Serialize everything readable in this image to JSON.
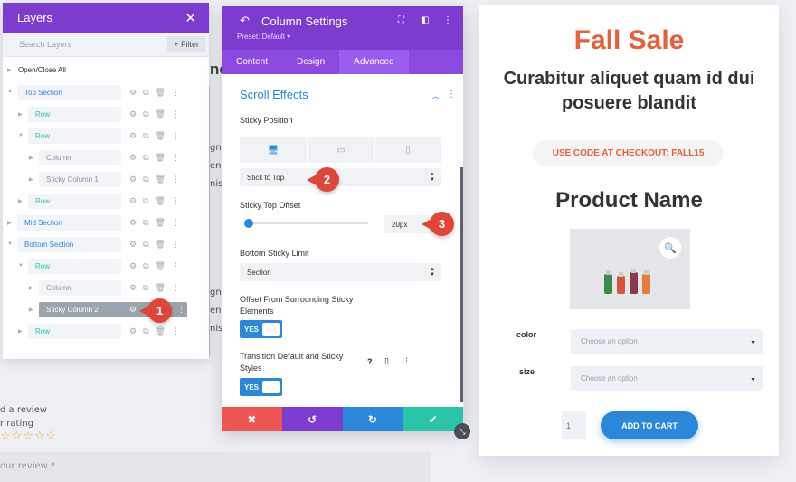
{
  "background": {
    "heading_fragment": "ne",
    "text_fragments_left": [
      "gna",
      "ena",
      "nis"
    ],
    "text_fragments_left2": [
      "gna",
      "ena",
      "nis"
    ],
    "review_title": "d a review",
    "rating_label": "r rating",
    "stars": "☆☆☆☆☆",
    "review_placeholder": "our review *"
  },
  "layers": {
    "title": "Layers",
    "close": "✕",
    "search_placeholder": "Search Layers",
    "filter_label": "+ Filter",
    "open_close_all": "Open/Close All",
    "items": [
      {
        "label": "Top Section"
      },
      {
        "label": "Row"
      },
      {
        "label": "Row"
      },
      {
        "label": "Column"
      },
      {
        "label": "Sticky Column 1"
      },
      {
        "label": "Row"
      },
      {
        "label": "Mid Section"
      },
      {
        "label": "Bottom Section"
      },
      {
        "label": "Row"
      },
      {
        "label": "Column"
      },
      {
        "label": "Sticky Column 2"
      },
      {
        "label": "Row"
      }
    ]
  },
  "settings": {
    "title": "Column Settings",
    "preset": "Preset: Default ▾",
    "tabs": [
      "Content",
      "Design",
      "Advanced"
    ],
    "section_title": "Scroll Effects",
    "sticky_position_label": "Sticky Position",
    "sticky_position_value": "Stick to Top",
    "sticky_offset_label": "Sticky Top Offset",
    "sticky_offset_value": "20px",
    "bottom_limit_label": "Bottom Sticky Limit",
    "bottom_limit_value": "Section",
    "offset_surrounding_label": "Offset From Surrounding Sticky Elements",
    "offset_surrounding_toggle": "YES",
    "transition_label": "Transition Default and Sticky Styles",
    "transition_toggle": "YES",
    "callouts": [
      "1",
      "2",
      "3"
    ],
    "footer_colors": [
      "#ef5555",
      "#7e3bd0",
      "#2b87da",
      "#29c4a9"
    ]
  },
  "product": {
    "headline": "Fall Sale",
    "subhead": "Curabitur aliquet quam id dui posuere blandit",
    "coupon": "USE CODE AT CHECKOUT: FALL15",
    "name": "Product Name",
    "color_label": "color",
    "size_label": "size",
    "choose_option": "Choose an option",
    "quantity": "1",
    "add_to_cart": "ADD TO CART",
    "accent": "#e8603a",
    "button_color": "#2b87da"
  }
}
